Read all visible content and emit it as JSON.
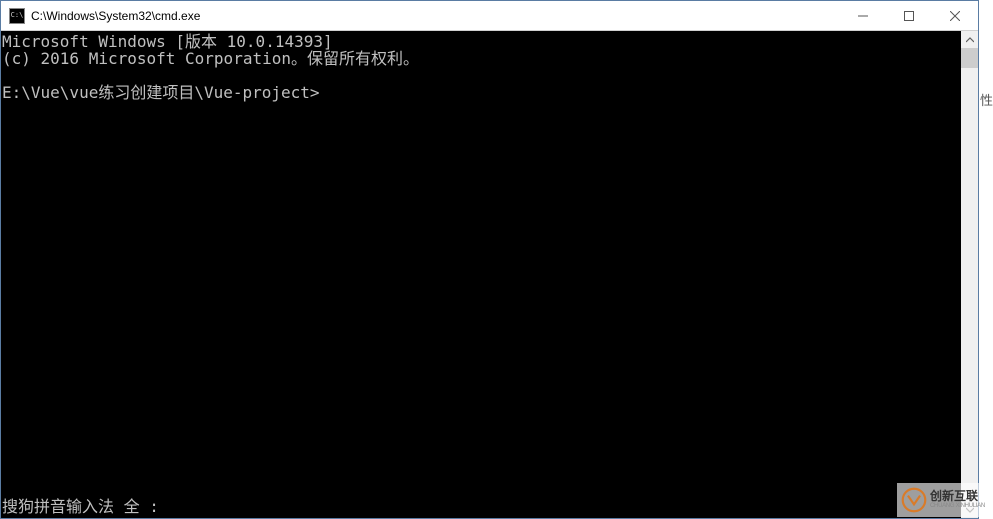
{
  "window": {
    "title": "C:\\Windows\\System32\\cmd.exe",
    "icon_text": "C:\\"
  },
  "console": {
    "line1": "Microsoft Windows [版本 10.0.14393]",
    "line2": "(c) 2016 Microsoft Corporation。保留所有权利。",
    "blank": "",
    "prompt": "E:\\Vue\\vue练习创建项目\\Vue-project>"
  },
  "ime": {
    "status": "搜狗拼音输入法 全 :"
  },
  "fragment": {
    "text": "性"
  },
  "watermark": {
    "main": "创新互联",
    "sub": "CHUANG XINHULIAN"
  }
}
